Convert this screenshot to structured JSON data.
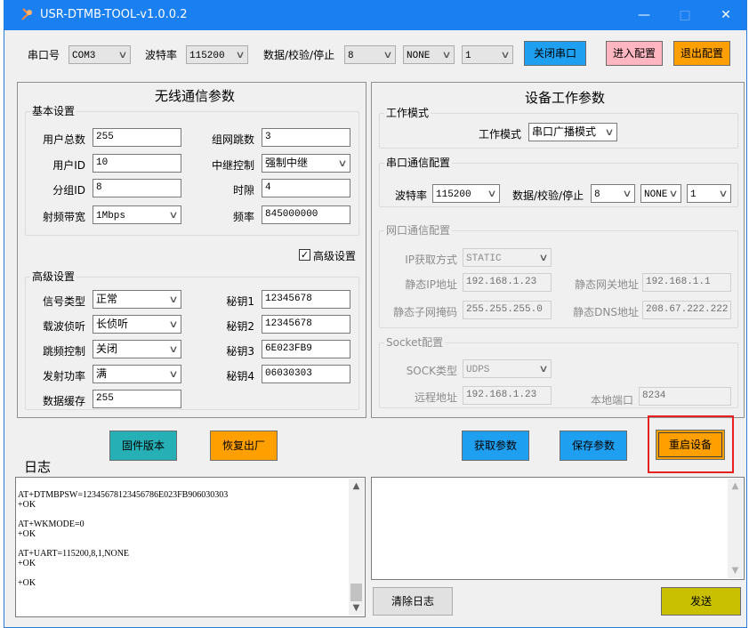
{
  "window": {
    "title": "USR-DTMB-TOOL-v1.0.0.2",
    "minimize": "—",
    "maximize": "□",
    "close": "✕"
  },
  "toolbar": {
    "port_label": "串口号",
    "port_value": "COM3",
    "baud_label": "波特率",
    "baud_value": "115200",
    "dps_label": "数据/校验/停止",
    "data_bits": "8",
    "parity": "NONE",
    "stop_bits": "1",
    "close_port": "关闭串口",
    "enter_config": "进入配置",
    "exit_config": "退出配置"
  },
  "wireless": {
    "title": "无线通信参数",
    "basic_group": "基本设置",
    "total_users_label": "用户总数",
    "total_users": "255",
    "network_hops_label": "组网跳数",
    "network_hops": "3",
    "user_id_label": "用户ID",
    "user_id": "10",
    "relay_label": "中继控制",
    "relay": "强制中继",
    "group_id_label": "分组ID",
    "group_id": "8",
    "slot_label": "时隙",
    "slot": "4",
    "rf_bw_label": "射频带宽",
    "rf_bw": "1Mbps",
    "freq_label": "频率",
    "freq": "845000000",
    "advanced_checkbox": "高级设置",
    "advanced_group": "高级设置",
    "signal_type_label": "信号类型",
    "signal_type": "正常",
    "key1_label": "秘钥1",
    "key1": "12345678",
    "carrier_label": "载波侦听",
    "carrier": "长侦听",
    "key2_label": "秘钥2",
    "key2": "12345678",
    "hopping_label": "跳频控制",
    "hopping": "关闭",
    "key3_label": "秘钥3",
    "key3": "6E023FB9",
    "power_label": "发射功率",
    "power": "满",
    "key4_label": "秘钥4",
    "key4": "06030303",
    "buffer_label": "数据缓存",
    "buffer": "255"
  },
  "device": {
    "title": "设备工作参数",
    "mode_group": "工作模式",
    "mode_label": "工作模式",
    "mode": "串口广播模式",
    "serial_group": "串口通信配置",
    "baud_label": "波特率",
    "baud": "115200",
    "dps_label": "数据/校验/停止",
    "data_bits": "8",
    "parity": "NONE",
    "stop_bits": "1",
    "net_group": "网口通信配置",
    "ip_mode_label": "IP获取方式",
    "ip_mode": "STATIC",
    "static_ip_label": "静态IP地址",
    "static_ip": "192.168.1.23",
    "gateway_label": "静态网关地址",
    "gateway": "192.168.1.1",
    "mask_label": "静态子网掩码",
    "mask": "255.255.255.0",
    "dns_label": "静态DNS地址",
    "dns": "208.67.222.222",
    "socket_group": "Socket配置",
    "sock_type_label": "SOCK类型",
    "sock_type": "UDPS",
    "remote_label": "远程地址",
    "remote": "192.168.1.23",
    "local_port_label": "本地端口",
    "local_port": "8234"
  },
  "actions": {
    "firmware": "固件版本",
    "factory": "恢复出厂",
    "get_params": "获取参数",
    "save_params": "保存参数",
    "restart": "重启设备"
  },
  "log": {
    "title": "日志",
    "lines": "AT+DTMBPSW=12345678123456786E023FB906030303\n+OK\n\nAT+WKMODE=0\n+OK\n\nAT+UART=115200,8,1,NONE\n+OK\n\n+OK",
    "clear": "清除日志",
    "send": "发送"
  },
  "icons": {
    "check": "✓",
    "chevron": "∨",
    "up": "▲",
    "down": "▼"
  }
}
